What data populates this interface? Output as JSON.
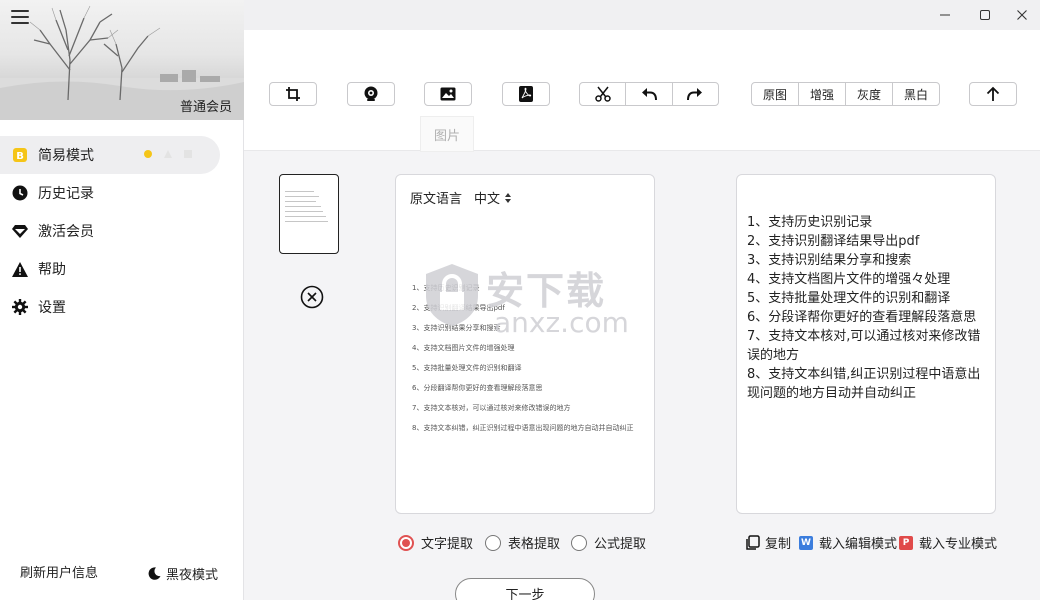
{
  "sidebar": {
    "member_tag": "普通会员",
    "items": [
      {
        "label": "简易模式",
        "icon": "b-badge-icon",
        "active": true
      },
      {
        "label": "历史记录",
        "icon": "clock-icon"
      },
      {
        "label": "激活会员",
        "icon": "diamond-icon"
      },
      {
        "label": "帮助",
        "icon": "warning-icon"
      },
      {
        "label": "设置",
        "icon": "gear-icon"
      }
    ],
    "refresh_label": "刷新用户信息",
    "night_label": "黑夜模式"
  },
  "toolbar": {
    "image_modes": [
      "原图",
      "增强",
      "灰度",
      "黑白"
    ],
    "tooltip": "图片",
    "buttons": [
      "crop-icon",
      "camera-icon",
      "image-icon",
      "pdf-icon",
      "cut-icon",
      "undo-icon",
      "redo-icon",
      "upload-icon"
    ]
  },
  "source_panel": {
    "lang_label": "原文语言",
    "lang_value": "中文",
    "preview_lines": [
      "1、支持历史识别记录",
      "2、支持识别翻译结果导出pdf",
      "3、支持识别结果分享和搜索",
      "4、支持文档图片文件的增强处理",
      "5、支持批量处理文件的识别和翻译",
      "6、分段翻译帮你更好的查看理解段落意思",
      "7、支持文本核对，可以通过核对来修改错误的地方",
      "8、支持文本纠错，纠正识别过程中语意出现问题的地方自动并自动纠正"
    ]
  },
  "result_panel": {
    "lines": [
      "1、支持历史识别记录",
      "2、支持识别翻译结果导出pdf",
      "3、支持识别结果分享和搜索",
      "4、支持文档图片文件的增强々处理",
      "5、支持批量处理文件的识别和翻译",
      "6、分段译帮你更好的查看理解段落意思",
      "7、支持文本核对,可以通过核对来修改错误的地方",
      "8、支持文本纠错,纠正识别过程中语意出现问题的地方目动并自动纠正"
    ]
  },
  "extract_options": [
    {
      "label": "文字提取",
      "checked": true
    },
    {
      "label": "表格提取",
      "checked": false
    },
    {
      "label": "公式提取",
      "checked": false
    }
  ],
  "actions": {
    "copy": "复制",
    "word": "载入编辑模式",
    "word_badge": "W",
    "pro": "载入专业模式",
    "pro_badge": "P"
  },
  "next_label": "下一步",
  "watermark": {
    "cn": "安下载",
    "en": "anxz.com"
  },
  "colors": {
    "accent_red": "#e05252",
    "word_blue": "#3b7ddd",
    "pdf_red": "#e04a4a",
    "status_yellow": "#f5c518"
  }
}
